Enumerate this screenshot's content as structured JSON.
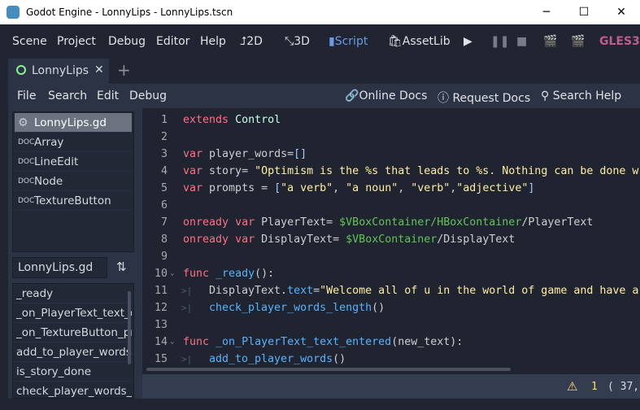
{
  "window": {
    "title": "Godot Engine - LonnyLips - LonnyLips.tscn",
    "minimize": "─",
    "maximize": "☐",
    "close": "✕"
  },
  "menu": {
    "items": [
      "Scene",
      "Project",
      "Debug",
      "Editor",
      "Help"
    ],
    "modes": [
      "2D",
      "3D",
      "Script",
      "AssetLib"
    ],
    "renderer": "GLES3",
    "accent": "#699ce8"
  },
  "scene_tabs": {
    "active": "LonnyLips",
    "close": "✕",
    "add": "+"
  },
  "script_menu": {
    "items": [
      "File",
      "Search",
      "Edit",
      "Debug"
    ],
    "online_docs": "Online Docs",
    "request_docs": "Request Docs",
    "search_help": "Search Help"
  },
  "script_list": [
    {
      "label": "LonnyLips.gd",
      "icon": "gear-icon",
      "selected": true
    },
    {
      "label": "Array",
      "icon": "doc-icon"
    },
    {
      "label": "LineEdit",
      "icon": "doc-icon"
    },
    {
      "label": "Node",
      "icon": "doc-icon"
    },
    {
      "label": "TextureButton",
      "icon": "doc-icon"
    }
  ],
  "method_filter": {
    "value": "LonnyLips.gd"
  },
  "methods": [
    "_ready",
    "_on_PlayerText_text_entered",
    "_on_TextureButton_pressed",
    "add_to_player_words",
    "is_story_done",
    "check_player_words_length"
  ],
  "code": [
    {
      "n": "1",
      "t": [
        [
          "k",
          "extends"
        ],
        [
          "p",
          " "
        ],
        [
          "c",
          "Control"
        ]
      ]
    },
    {
      "n": "2",
      "t": []
    },
    {
      "n": "3",
      "t": [
        [
          "k",
          "var"
        ],
        [
          "p",
          " player_words="
        ],
        [
          "b",
          "[]"
        ]
      ]
    },
    {
      "n": "4",
      "t": [
        [
          "k",
          "var"
        ],
        [
          "p",
          " story= "
        ],
        [
          "s",
          "\"Optimism is the %s that leads to %s. Nothing can be done w"
        ]
      ]
    },
    {
      "n": "5",
      "t": [
        [
          "k",
          "var"
        ],
        [
          "p",
          " prompts = "
        ],
        [
          "b",
          "["
        ],
        [
          "s",
          "\"a verb\""
        ],
        [
          "p",
          ", "
        ],
        [
          "s",
          "\"a noun\""
        ],
        [
          "p",
          ", "
        ],
        [
          "s",
          "\"verb\""
        ],
        [
          "p",
          ","
        ],
        [
          "s",
          "\"adjective\""
        ],
        [
          "b",
          "]"
        ]
      ]
    },
    {
      "n": "6",
      "t": []
    },
    {
      "n": "7",
      "t": [
        [
          "k",
          "onready"
        ],
        [
          "p",
          " "
        ],
        [
          "k",
          "var"
        ],
        [
          "p",
          " PlayerText= "
        ],
        [
          "g",
          "$VBoxContainer/HBoxContainer"
        ],
        [
          "p",
          "/PlayerText"
        ]
      ]
    },
    {
      "n": "8",
      "t": [
        [
          "k",
          "onready"
        ],
        [
          "p",
          " "
        ],
        [
          "k",
          "var"
        ],
        [
          "p",
          " DisplayText= "
        ],
        [
          "g",
          "$VBoxContainer"
        ],
        [
          "p",
          "/DisplayText"
        ]
      ]
    },
    {
      "n": "9",
      "t": []
    },
    {
      "n": "10",
      "fold": true,
      "t": [
        [
          "k",
          "func"
        ],
        [
          "p",
          " "
        ],
        [
          "f",
          "_ready"
        ],
        [
          "p",
          "():"
        ]
      ]
    },
    {
      "n": "11",
      "indent": true,
      "t": [
        [
          "p",
          "DisplayText."
        ],
        [
          "f",
          "text"
        ],
        [
          "p",
          "="
        ],
        [
          "s",
          "\"Welcome all of u in the world of game and have a"
        ]
      ]
    },
    {
      "n": "12",
      "indent": true,
      "t": [
        [
          "f",
          "check_player_words_length"
        ],
        [
          "p",
          "()"
        ]
      ]
    },
    {
      "n": "13",
      "t": []
    },
    {
      "n": "14",
      "fold": true,
      "t": [
        [
          "k",
          "func"
        ],
        [
          "p",
          " "
        ],
        [
          "f",
          "_on_PlayerText_text_entered"
        ],
        [
          "p",
          "(new_text):"
        ]
      ]
    },
    {
      "n": "15",
      "indent": true,
      "t": [
        [
          "f",
          "add_to_player_words"
        ],
        [
          "p",
          "()"
        ]
      ]
    }
  ],
  "colors": {
    "k": "#ff7085",
    "p": "#cdcfd2",
    "c": "#c7ffed",
    "s": "#ffeda1",
    "f": "#57b3ff",
    "g": "#63c259",
    "b": "#abc9ff"
  },
  "status": {
    "warnings": "1",
    "position": "( 37,"
  }
}
